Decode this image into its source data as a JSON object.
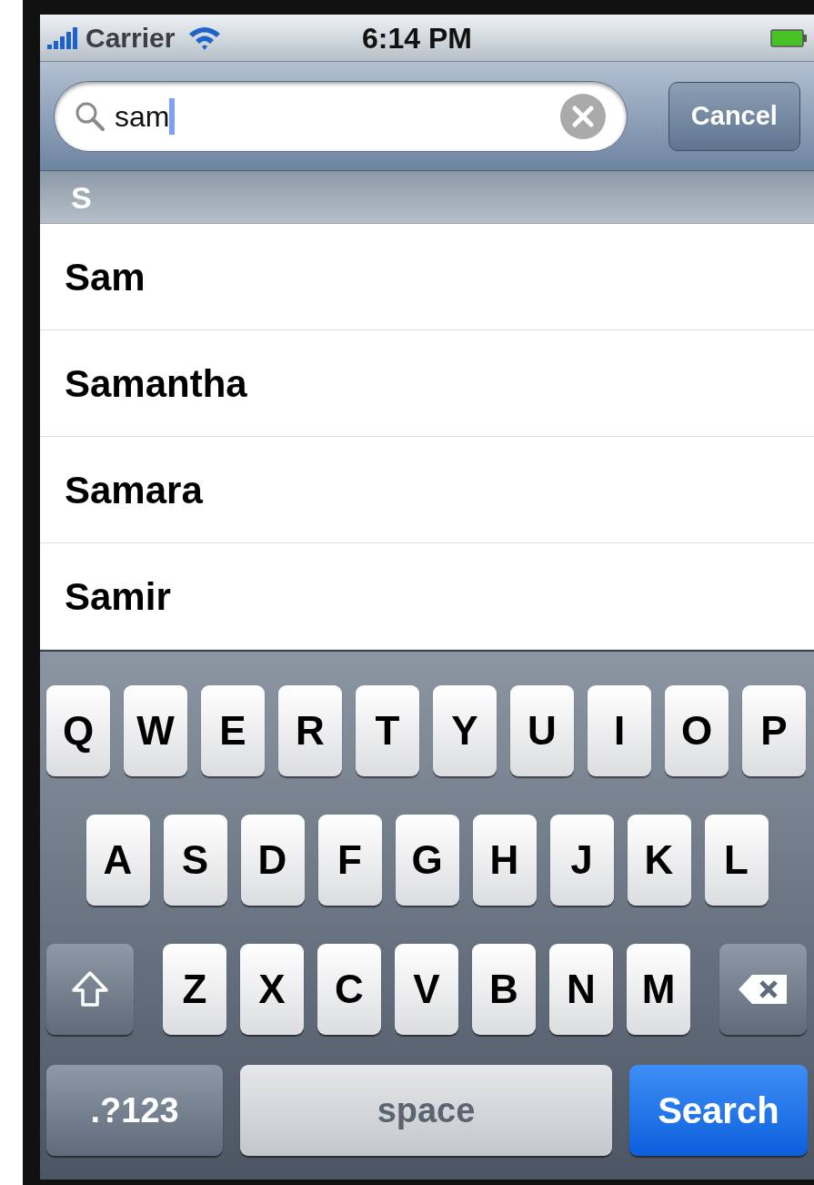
{
  "status_bar": {
    "carrier": "Carrier",
    "time": "6:14 PM"
  },
  "search": {
    "value": "sam",
    "cancel": "Cancel"
  },
  "section_header": "S",
  "results": [
    "Sam",
    "Samantha",
    "Samara",
    "Samir"
  ],
  "keyboard": {
    "top_keys": [
      {
        "kind": "letter",
        "label": "Q"
      },
      {
        "kind": "letter",
        "label": "W"
      },
      {
        "kind": "letter",
        "label": "E"
      },
      {
        "kind": "letter",
        "label": "R"
      },
      {
        "kind": "letter",
        "label": "T"
      },
      {
        "kind": "letter",
        "label": "Y"
      },
      {
        "kind": "letter",
        "label": "U"
      },
      {
        "kind": "letter",
        "label": "I"
      },
      {
        "kind": "letter",
        "label": "O"
      },
      {
        "kind": "letter",
        "label": "P"
      }
    ],
    "home_keys": [
      {
        "kind": "letter",
        "label": "A"
      },
      {
        "kind": "letter",
        "label": "S"
      },
      {
        "kind": "letter",
        "label": "D"
      },
      {
        "kind": "letter",
        "label": "F"
      },
      {
        "kind": "letter",
        "label": "G"
      },
      {
        "kind": "letter",
        "label": "H"
      },
      {
        "kind": "letter",
        "label": "J"
      },
      {
        "kind": "letter",
        "label": "K"
      },
      {
        "kind": "letter",
        "label": "L"
      }
    ],
    "bottom_keys": [
      {
        "kind": "shift"
      },
      {
        "kind": "letter",
        "label": "Z"
      },
      {
        "kind": "letter",
        "label": "X"
      },
      {
        "kind": "letter",
        "label": "C"
      },
      {
        "kind": "letter",
        "label": "V"
      },
      {
        "kind": "letter",
        "label": "B"
      },
      {
        "kind": "letter",
        "label": "N"
      },
      {
        "kind": "letter",
        "label": "M"
      },
      {
        "kind": "delete"
      }
    ],
    "function_keys": [
      {
        "kind": "mode",
        "label": ".?123"
      },
      {
        "kind": "space",
        "label": "space"
      },
      {
        "kind": "action",
        "label": "Search"
      }
    ]
  }
}
